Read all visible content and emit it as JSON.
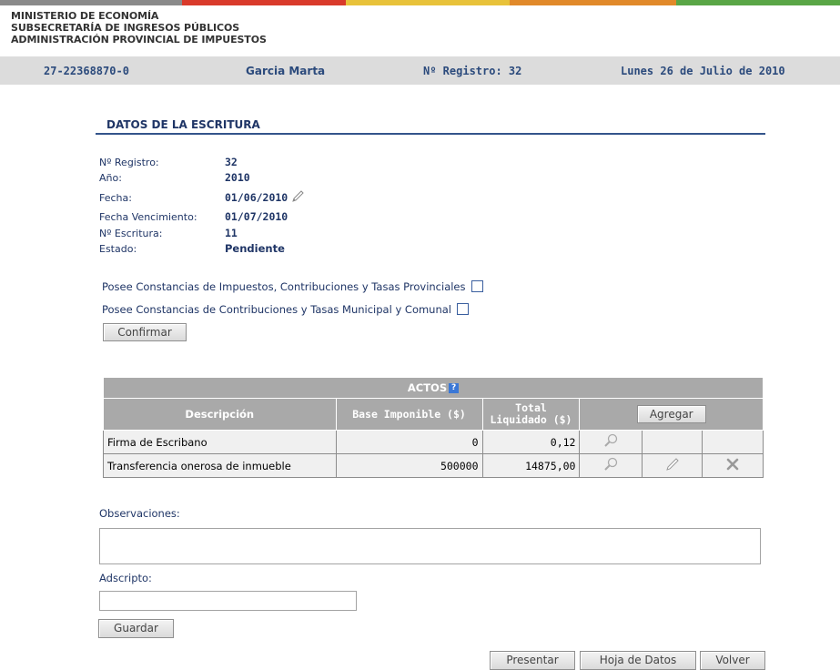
{
  "header": {
    "ministry_lines": [
      "MINISTERIO DE ECONOMÍA",
      "SUBSECRETARÍA DE INGRESOS PÚBLICOS",
      "ADMINISTRACIÓN PROVINCIAL DE IMPUESTOS"
    ],
    "stripe_colors": [
      "#8a8a8a",
      "#d93a2b",
      "#e8c23a",
      "#e1892a",
      "#5aa646"
    ]
  },
  "infobar": {
    "cuit": "27-22368870-0",
    "user": "Garcia Marta",
    "registro": "Nº Registro: 32",
    "date": "Lunes 26 de Julio de 2010"
  },
  "escritura": {
    "title": "DATOS DE LA ESCRITURA",
    "fields": [
      {
        "label": "Nº Registro:",
        "value": "32"
      },
      {
        "label": "Año:",
        "value": "2010"
      },
      {
        "label": "Fecha:",
        "value": "01/06/2010"
      },
      {
        "label": "Fecha Vencimiento:",
        "value": "01/07/2010"
      },
      {
        "label": "Nº Escritura:",
        "value": "11"
      },
      {
        "label": "Estado:",
        "value": "Pendiente"
      }
    ]
  },
  "checks": {
    "provinciales": "Posee Constancias de Impuestos, Contribuciones y Tasas Provinciales",
    "municipal": "Posee Constancias de Contribuciones y Tasas Municipal y Comunal",
    "confirm": "Confirmar"
  },
  "actos": {
    "title": "ACTOS",
    "help": "?",
    "columns": {
      "desc": "Descripción",
      "base": "Base Imponible ($)",
      "total_1": "Total",
      "total_2": "Liquidado ($)"
    },
    "add": "Agregar",
    "rows": [
      {
        "desc": "Firma de Escribano",
        "base": "0",
        "total": "0,12"
      },
      {
        "desc": "Transferencia onerosa de inmueble",
        "base": "500000",
        "total": "14875,00"
      }
    ]
  },
  "form": {
    "observaciones": "Observaciones:",
    "adscripto": "Adscripto:",
    "guardar": "Guardar"
  },
  "footer": {
    "presentar": "Presentar",
    "hoja": "Hoja de Datos",
    "volver": "Volver"
  }
}
